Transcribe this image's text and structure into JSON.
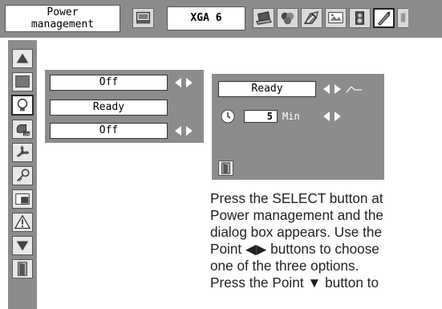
{
  "header": {
    "menu_title_line1": "Power",
    "menu_title_line2": "management",
    "input_name": "XGA 6",
    "toolbar_icons": [
      "computer-input-icon",
      "laptop-icon",
      "image-adjust-icon",
      "color-adjust-icon",
      "screen-icon",
      "sound-icon",
      "setting-icon"
    ]
  },
  "sidebar": {
    "items": [
      "up-arrow-icon",
      "menu-screen-icon",
      "lamp-icon",
      "power-on-icon",
      "fan-icon",
      "key-icon",
      "image-icon",
      "warning-icon",
      "down-arrow-icon",
      "exit-icon"
    ],
    "active_index": 2
  },
  "panel": {
    "rows": [
      {
        "value": "Off",
        "has_arrows": true
      },
      {
        "value": "Ready",
        "has_arrows": false
      },
      {
        "value": "Off",
        "has_arrows": true
      }
    ]
  },
  "dialog": {
    "mode_value": "Ready",
    "timer_value": "5",
    "timer_unit": "Min"
  },
  "description": [
    "Press the SELECT button at",
    "Power management and the",
    "dialog box appears. Use the",
    "Point ◀▶ buttons to choose",
    "one of the three options.",
    "Press the Point ▼ button to"
  ],
  "colors": {
    "panel_bg": "#8c8c8c",
    "field_bg": "#ffffff",
    "arrow": "#ffffff",
    "text": "#222222"
  }
}
